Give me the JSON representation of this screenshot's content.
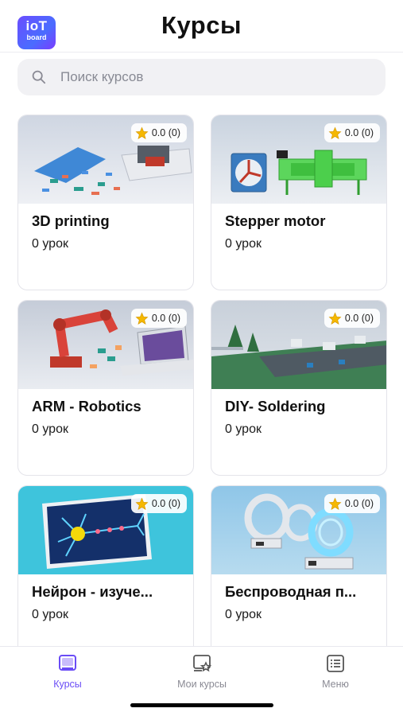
{
  "app": {
    "logo_line1": "ioT",
    "logo_line2": "board",
    "title": "Курсы"
  },
  "search": {
    "placeholder": "Поиск курсов",
    "value": ""
  },
  "courses": [
    {
      "title": "3D printing",
      "rating": "0.0 (0)",
      "lessons": "0 урок",
      "image": "3d-printer-kit"
    },
    {
      "title": "Stepper motor",
      "rating": "0.0 (0)",
      "lessons": "0 урок",
      "image": "stepper-motor-kit"
    },
    {
      "title": "ARM - Robotics",
      "rating": "0.0 (0)",
      "lessons": "0 урок",
      "image": "robot-arm-kit"
    },
    {
      "title": "DIY- Soldering",
      "rating": "0.0 (0)",
      "lessons": "0 урок",
      "image": "diy-soldering-board"
    },
    {
      "title": "Нейрон - изуче...",
      "rating": "0.0 (0)",
      "lessons": "0 урок",
      "image": "neuron-panel"
    },
    {
      "title": "Беспроводная п...",
      "rating": "0.0 (0)",
      "lessons": "0 урок",
      "image": "wireless-coils"
    }
  ],
  "tabs": [
    {
      "label": "Курсы",
      "icon": "book-icon",
      "active": true
    },
    {
      "label": "Мои курсы",
      "icon": "my-courses-icon",
      "active": false
    },
    {
      "label": "Меню",
      "icon": "menu-list-icon",
      "active": false
    }
  ],
  "colors": {
    "accent": "#6a4cf6",
    "star": "#f5b800",
    "inactive": "#8a8a94"
  }
}
